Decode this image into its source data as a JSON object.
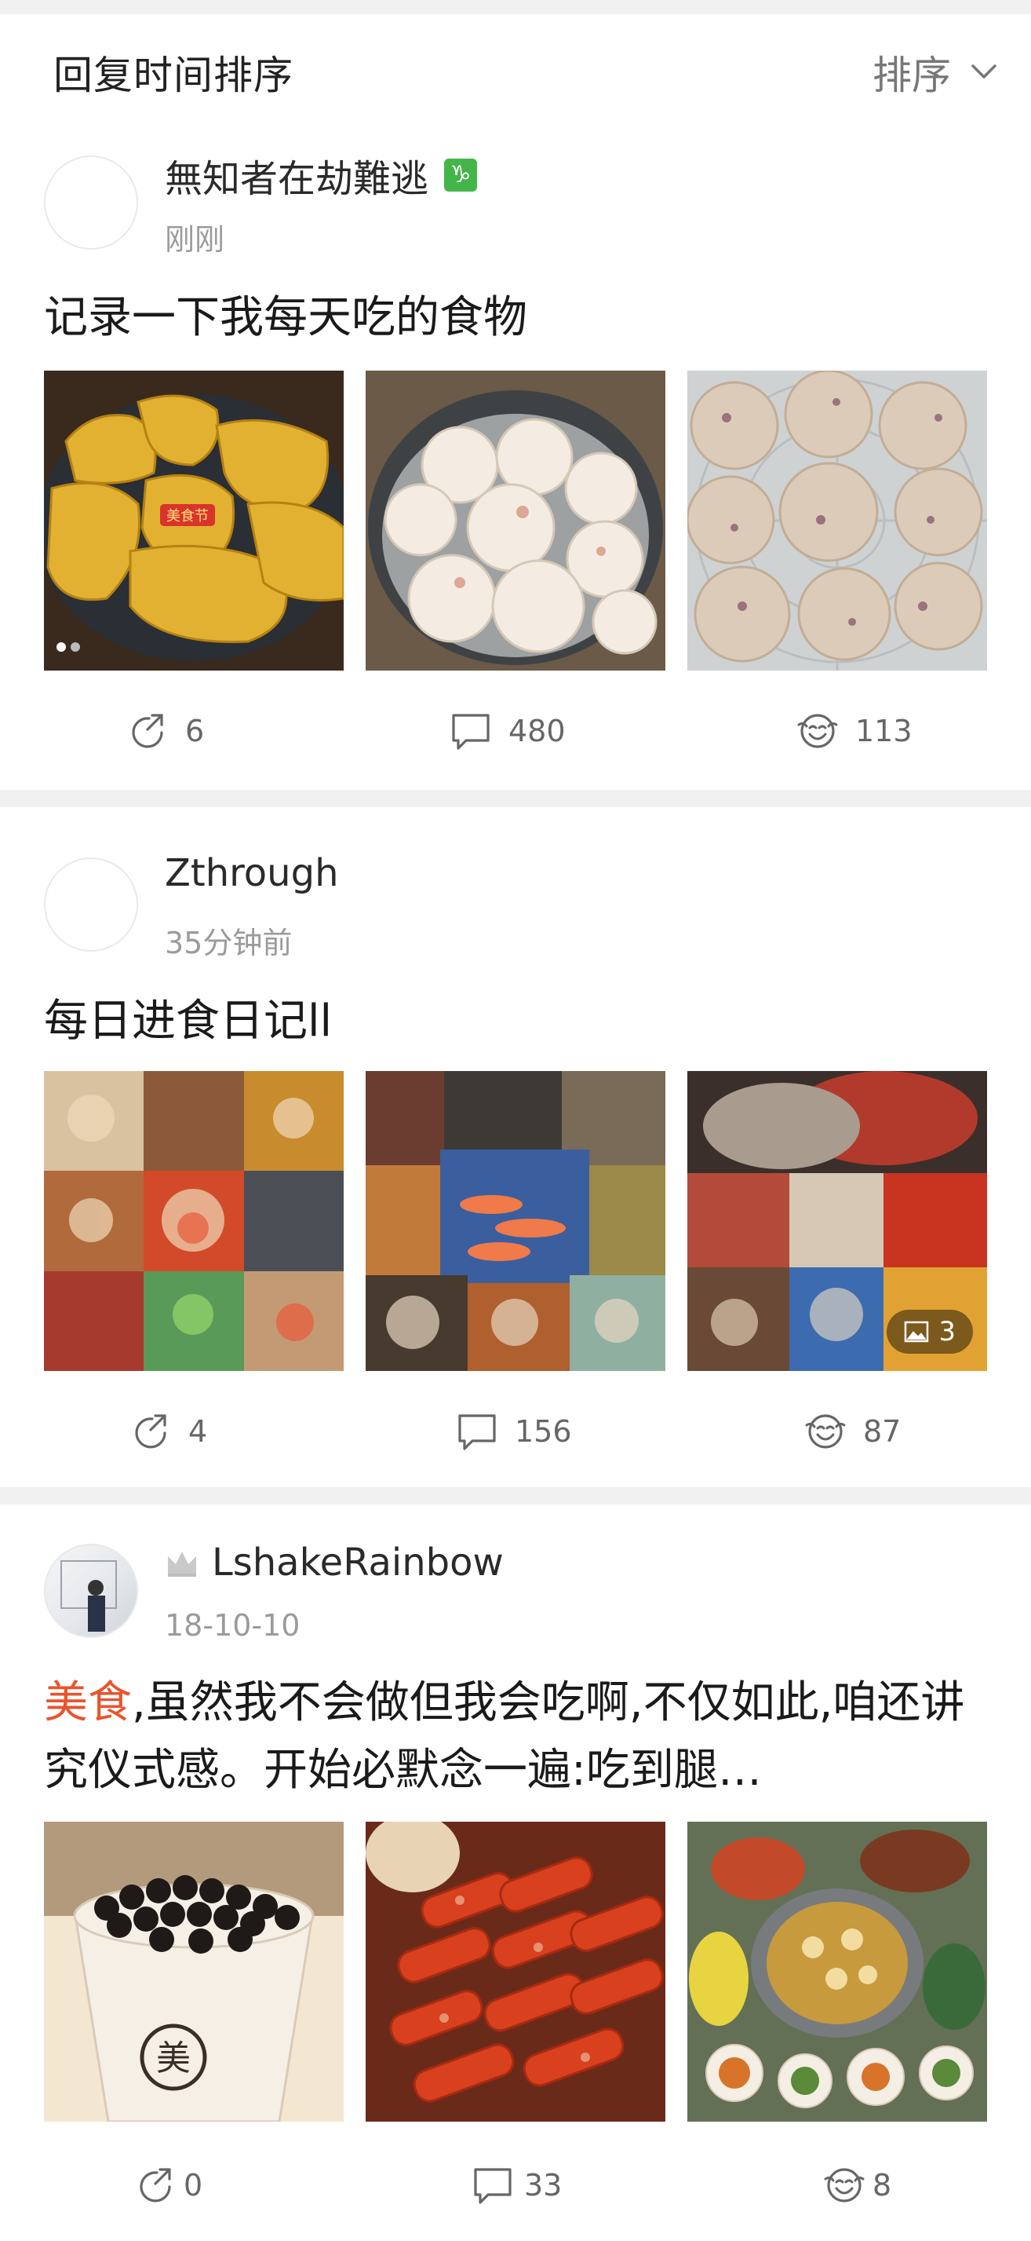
{
  "sort": {
    "title": "回复时间排序",
    "control_label": "排序"
  },
  "posts": [
    {
      "user": "無知者在劫難逃",
      "badge": "♑",
      "time": "刚刚",
      "text_highlight": "",
      "text": "记录一下我每天吃的食物",
      "images": [
        {
          "desc": "golden rice cakes on plate",
          "stamp": "美食节"
        },
        {
          "desc": "steamed buns in pot"
        },
        {
          "desc": "purple rice steamed buns"
        }
      ],
      "reposts": "6",
      "comments": "480",
      "likes": "113"
    },
    {
      "user": "Zthrough",
      "time": "35分钟前",
      "text_highlight": "",
      "text": "每日进食日记ll",
      "images": [
        {
          "desc": "food collage 1"
        },
        {
          "desc": "food collage 2"
        },
        {
          "desc": "food collage 3",
          "extra_count": "3"
        }
      ],
      "reposts": "4",
      "comments": "156",
      "likes": "87"
    },
    {
      "user": "LshakeRainbow",
      "time": "18-10-10",
      "text_highlight": "美食",
      "text": ",虽然我不会做但我会吃啊,不仅如此,咱还讲究仪式感。开始必默念一遍:吃到腿…",
      "images": [
        {
          "desc": "bubble tea cup",
          "cup_text": "美"
        },
        {
          "desc": "grilled skewers"
        },
        {
          "desc": "hot pot spread"
        }
      ],
      "reposts": "0",
      "comments": "33",
      "likes": "8"
    }
  ],
  "colors": {
    "separator": "#f1f1f1",
    "highlight": "#e8542d",
    "badge": "#44b549",
    "muted": "#9b9b9b"
  }
}
